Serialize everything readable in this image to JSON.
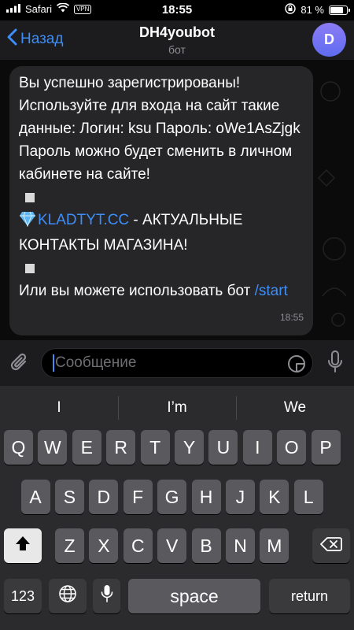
{
  "status_bar": {
    "carrier": "Safari",
    "vpn": "VPN",
    "time": "18:55",
    "battery_text": "81 %",
    "battery_level": 0.81
  },
  "nav": {
    "back_label": "Назад",
    "title": "DH4youbot",
    "subtitle": "бот",
    "avatar_letter": "D",
    "accent": "#3e8ef7"
  },
  "message": {
    "line1": "Вы успешно зарегистрированы!",
    "line2": "Используйте для входа на сайт такие данные: Логин: ksu  Пароль: oWe1AsZjgk",
    "line3": "Пароль можно будет сменить в личном кабинете на сайте!",
    "link_text": "KLADTYT.CC",
    "line4_rest": " - АКТУАЛЬНЫЕ КОНТАКТЫ МАГАЗИНА!",
    "line5": "Или вы можете использовать бот ",
    "bot_command": "/start",
    "time": "18:55"
  },
  "input": {
    "placeholder": "Сообщение"
  },
  "keyboard": {
    "suggestions": [
      "I",
      "I’m",
      "We"
    ],
    "row1": [
      "Q",
      "W",
      "E",
      "R",
      "T",
      "Y",
      "U",
      "I",
      "O",
      "P"
    ],
    "row2": [
      "A",
      "S",
      "D",
      "F",
      "G",
      "H",
      "J",
      "K",
      "L"
    ],
    "row3": [
      "Z",
      "X",
      "C",
      "V",
      "B",
      "N",
      "M"
    ],
    "numbers_key": "123",
    "space_key": "space",
    "return_key": "return"
  },
  "icons": [
    "back-chevron-icon",
    "paperclip-icon",
    "sticker-icon",
    "microphone-icon",
    "shift-icon",
    "backspace-icon",
    "globe-icon",
    "keyboard-mic-icon",
    "gem-icon",
    "wifi-icon",
    "signal-icon",
    "lock-rotation-icon",
    "battery-icon"
  ]
}
